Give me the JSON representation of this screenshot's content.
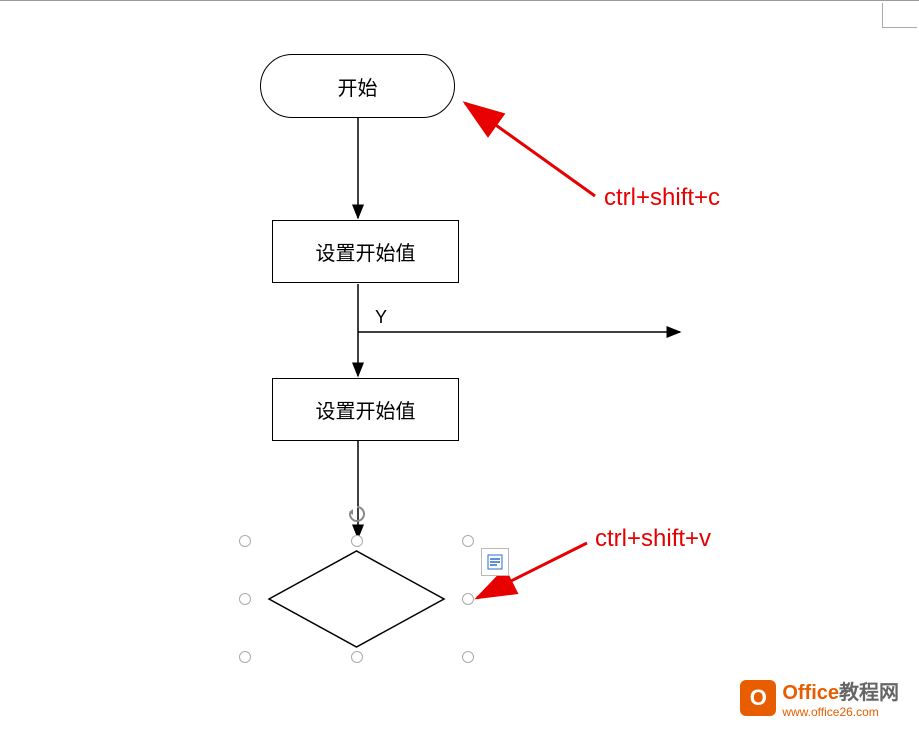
{
  "flowchart": {
    "start": "开始",
    "process1": "设置开始值",
    "y_label": "Y",
    "process2": "设置开始值"
  },
  "annotations": {
    "copy": "ctrl+shift+c",
    "paste": "ctrl+shift+v"
  },
  "logo": {
    "icon_letter": "O",
    "title_orange": "Office",
    "title_gray": "教程网",
    "url": "www.office26.com"
  },
  "colors": {
    "arrow_red": "#e60000",
    "orange": "#e85d00"
  }
}
